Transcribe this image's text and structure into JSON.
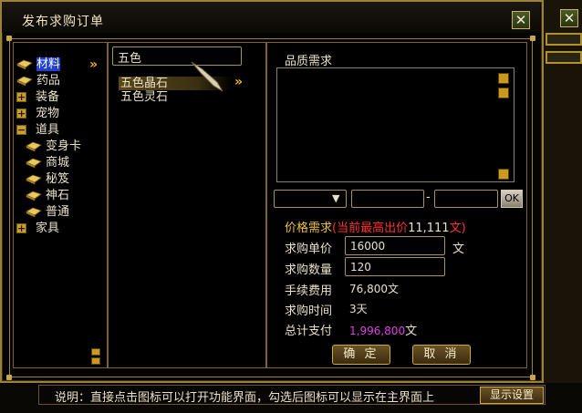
{
  "window": {
    "title": "发布求购订单"
  },
  "search": {
    "value": "五色"
  },
  "tree": [
    {
      "label": "材料",
      "icon": "book-icon",
      "selected": true
    },
    {
      "label": "药品",
      "icon": "book-icon"
    },
    {
      "label": "装备",
      "toggle": "+"
    },
    {
      "label": "宠物",
      "toggle": "+"
    },
    {
      "label": "道具",
      "toggle": "−"
    },
    {
      "label": "变身卡",
      "icon": "book-icon",
      "indent": true
    },
    {
      "label": "商城",
      "icon": "book-icon",
      "indent": true
    },
    {
      "label": "秘笈",
      "icon": "book-icon",
      "indent": true
    },
    {
      "label": "神石",
      "icon": "book-icon",
      "indent": true
    },
    {
      "label": "普通",
      "icon": "book-icon",
      "indent": true
    },
    {
      "label": "家具",
      "toggle": "+"
    }
  ],
  "results": [
    {
      "label": "五色晶石",
      "highlighted": true
    },
    {
      "label": "五色灵石"
    }
  ],
  "quality": {
    "label": "品质需求",
    "dash": "-",
    "ok_label": "OK"
  },
  "price": {
    "label": "价格需求",
    "highest_label": "(当前最高出价",
    "highest_value": "11,111",
    "highest_unit": "文",
    "highest_close": ")"
  },
  "form": {
    "unit_price_label": "求购单价",
    "unit_price_value": "16000",
    "unit_price_unit": "文",
    "quantity_label": "求购数量",
    "quantity_value": "120",
    "fee_label": "手续费用",
    "fee_value": "76,800文",
    "time_label": "求购时间",
    "time_value": "3天",
    "total_label": "总计支付",
    "total_value": "1,996,800",
    "total_unit": "文"
  },
  "buttons": {
    "confirm": "确 定",
    "cancel": "取 消"
  },
  "footer": {
    "hint": "说明：直接点击图标可以打开功能界面，勾选后图标可以显示在主界面上",
    "show_button": "显示设置"
  },
  "colors": {
    "border_gold": "#9a8038",
    "price_red": "#ff3030",
    "total_purple": "#e040e0",
    "selected_blue": "#2040d0"
  }
}
